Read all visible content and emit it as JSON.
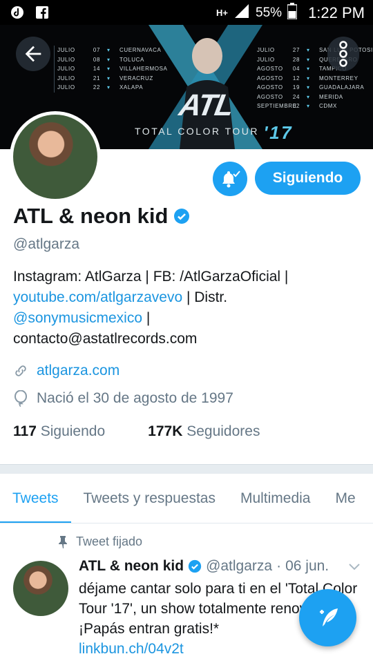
{
  "status_bar": {
    "left_icons": [
      "tiktok-icon",
      "facebook-icon"
    ],
    "network": "H+",
    "battery": "55%",
    "time": "1:22 PM"
  },
  "banner": {
    "title": "ATL",
    "tour_name": "TOTAL COLOR TOUR",
    "tour_year": "'17",
    "dates_left": [
      {
        "month": "JULIO",
        "day": "07",
        "city": "CUERNAVACA"
      },
      {
        "month": "JULIO",
        "day": "08",
        "city": "TOLUCA"
      },
      {
        "month": "JULIO",
        "day": "14",
        "city": "VILLAHERMOSA"
      },
      {
        "month": "JULIO",
        "day": "21",
        "city": "VERACRUZ"
      },
      {
        "month": "JULIO",
        "day": "22",
        "city": "XALAPA"
      }
    ],
    "dates_right": [
      {
        "month": "JULIO",
        "day": "27",
        "city": "SAN LUIS POTOSI"
      },
      {
        "month": "JULIO",
        "day": "28",
        "city": "QUERETARO"
      },
      {
        "month": "AGOSTO",
        "day": "04",
        "city": "TAMPICO"
      },
      {
        "month": "AGOSTO",
        "day": "12",
        "city": "MONTERREY"
      },
      {
        "month": "AGOSTO",
        "day": "19",
        "city": "GUADALAJARA"
      },
      {
        "month": "AGOSTO",
        "day": "24",
        "city": "MERIDA"
      },
      {
        "month": "SEPTIEMBRE",
        "day": "02",
        "city": "CDMX"
      }
    ]
  },
  "actions": {
    "follow_label": "Siguiendo"
  },
  "profile": {
    "name": "ATL & neon kid",
    "handle": "@atlgarza",
    "bio_line1": "Instagram: AtlGarza | FB: /AtlGarzaOficial |",
    "bio_link1": "youtube.com/atlgarzavevo",
    "bio_text2": " | Distr.",
    "bio_link2": "@sonymusicmexico",
    "bio_text3": " |",
    "bio_line4": "contacto@astatlrecords.com",
    "website": "atlgarza.com",
    "birthday": "Nació el 30 de agosto de 1997",
    "following_count": "117",
    "following_label": "Siguiendo",
    "followers_count": "177K",
    "followers_label": "Seguidores"
  },
  "tabs": [
    {
      "label": "Tweets",
      "active": true
    },
    {
      "label": "Tweets y respuestas",
      "active": false
    },
    {
      "label": "Multimedia",
      "active": false
    },
    {
      "label": "Me",
      "active": false
    }
  ],
  "tweet": {
    "pinned_label": "Tweet fijado",
    "author_name": "ATL & neon kid",
    "author_handle": "@atlgarza",
    "separator": "·",
    "date": "06 jun.",
    "text": "déjame cantar solo para ti en el 'Total Color Tour '17', un show totalmente renovado. ¡Papás entran gratis!*",
    "link": "linkbun.ch/04v2t"
  },
  "colors": {
    "accent": "#1da1f2",
    "link": "#1b95e0",
    "muted": "#657786"
  }
}
